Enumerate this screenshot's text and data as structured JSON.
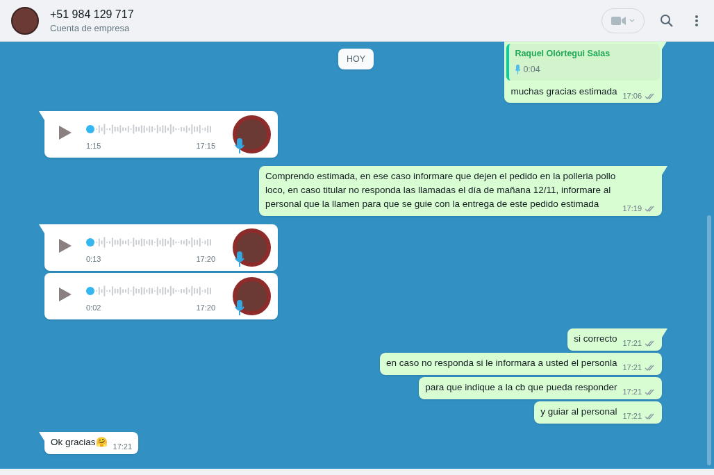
{
  "header": {
    "title": "+51 984 129 717",
    "subtitle": "Cuenta de empresa"
  },
  "date_pill": "HOY",
  "messages": [
    {
      "kind": "quoted_reply",
      "outgoing": true,
      "tail": true,
      "quote_author": "Raquel Olórtegui Salas",
      "quote_text": "0:04",
      "text": "muchas gracias estimada",
      "time": "17:06",
      "read": false
    },
    {
      "kind": "voice",
      "outgoing": false,
      "tail": true,
      "duration": "1:15",
      "time": "17:15",
      "level": 0
    },
    {
      "kind": "text",
      "outgoing": true,
      "tail": true,
      "text": "Comprendo estimada, en ese caso informare que dejen el pedido en la polleria pollo loco, en caso titular no responda las llamadas el día de mañana 12/11, informare al personal que la llamen para que se guie con la entrega de este pedido estimada",
      "time": "17:19",
      "read": false
    },
    {
      "kind": "voice",
      "outgoing": false,
      "tail": true,
      "duration": "0:13",
      "time": "17:20",
      "level": 0
    },
    {
      "kind": "voice",
      "outgoing": false,
      "tail": false,
      "duration": "0:02",
      "time": "17:20",
      "level": 0
    },
    {
      "kind": "text",
      "outgoing": true,
      "tail": true,
      "text": "si correcto",
      "time": "17:21",
      "read": false
    },
    {
      "kind": "text",
      "outgoing": true,
      "tail": false,
      "text": "en caso no responda si le informara a usted el personla",
      "time": "17:21",
      "read": false
    },
    {
      "kind": "text",
      "outgoing": true,
      "tail": false,
      "text": "para que indique a la cb que pueda responder",
      "time": "17:21",
      "read": false
    },
    {
      "kind": "text",
      "outgoing": true,
      "tail": false,
      "text": "y guiar al personal",
      "time": "17:21",
      "read": false
    },
    {
      "kind": "text",
      "outgoing": false,
      "tail": true,
      "text": "Ok gracias🤗",
      "time": "17:21"
    }
  ]
}
